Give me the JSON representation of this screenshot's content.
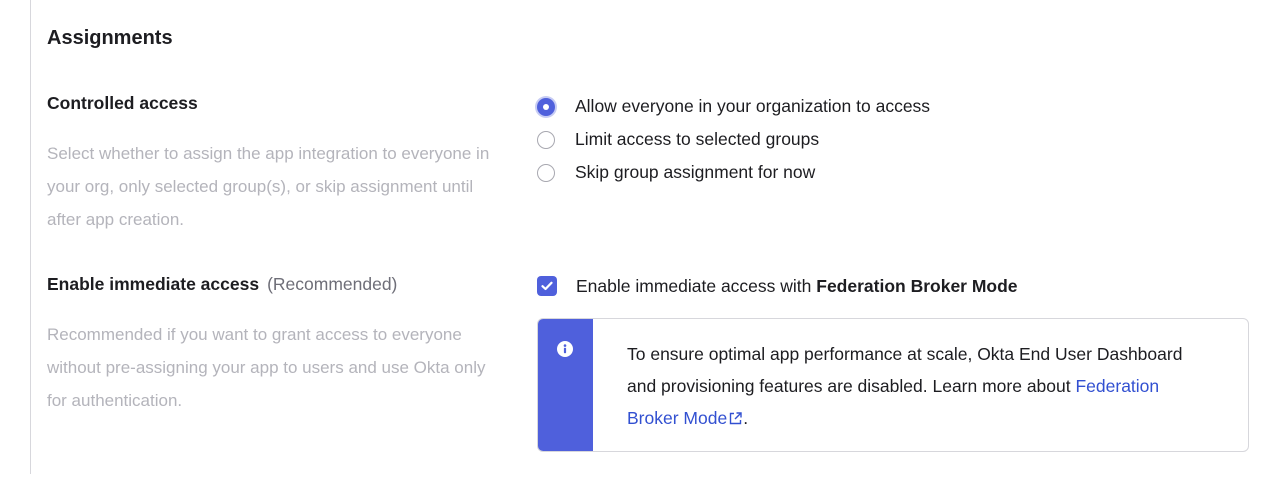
{
  "section": {
    "title": "Assignments"
  },
  "controlled_access": {
    "label": "Controlled access",
    "description": "Select whether to assign the app integration to everyone in your org, only selected group(s), or skip assignment until after app creation.",
    "options": [
      {
        "label": "Allow everyone in your organization to access",
        "selected": true
      },
      {
        "label": "Limit access to selected groups",
        "selected": false
      },
      {
        "label": "Skip group assignment for now",
        "selected": false
      }
    ]
  },
  "immediate_access": {
    "label": "Enable immediate access",
    "label_note": "(Recommended)",
    "description": "Recommended if you want to grant access to everyone without pre-assigning your app to users and use Okta only for authentication.",
    "checkbox_prefix": "Enable immediate access with ",
    "checkbox_bold": "Federation Broker Mode",
    "checked": true
  },
  "callout": {
    "icon": "info-icon",
    "text_before": "To ensure optimal app performance at scale, Okta End User Dashboard and provisioning features are disabled. Learn more about ",
    "link_text": "Federation Broker Mode",
    "link_icon": "external-link-icon",
    "text_after": "."
  },
  "colors": {
    "accent": "#4f60dc",
    "link": "#3250d1",
    "muted_text": "#b4b4bb"
  }
}
